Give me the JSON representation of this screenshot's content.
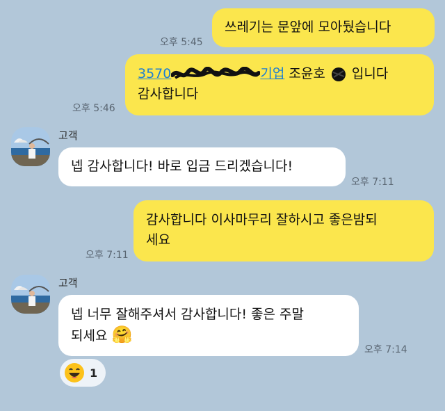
{
  "messages": {
    "m1": {
      "text": "쓰레기는 문앞에 모아뒀습니다",
      "time": "오후 5:45"
    },
    "m2": {
      "account_prefix": "3570",
      "bank": "기업",
      "rest": " 조윤호 ",
      "suffix": " 입니다",
      "line2": "감사합니다",
      "time": "오후 5:46"
    },
    "m3": {
      "sender": "고객",
      "text": "넵 감사합니다! 바로 입금 드리겠습니다!",
      "time": "오후 7:11"
    },
    "m4": {
      "line1": "감사합니다 이사마무리 잘하시고 좋은밤되",
      "line2": "세요",
      "time": "오후 7:11"
    },
    "m5": {
      "sender": "고객",
      "line1": "넵 너무 잘해주셔서 감사합니다! 좋은 주말",
      "line2": "되세요",
      "emoji": "🤗",
      "time": "오후 7:14"
    }
  },
  "reaction": {
    "icon": "grinning-face-emoji",
    "count": "1"
  },
  "colors": {
    "background": "#b2c7d9",
    "my_bubble": "#fbe64d",
    "their_bubble": "#ffffff",
    "link": "#1e7fd0"
  }
}
